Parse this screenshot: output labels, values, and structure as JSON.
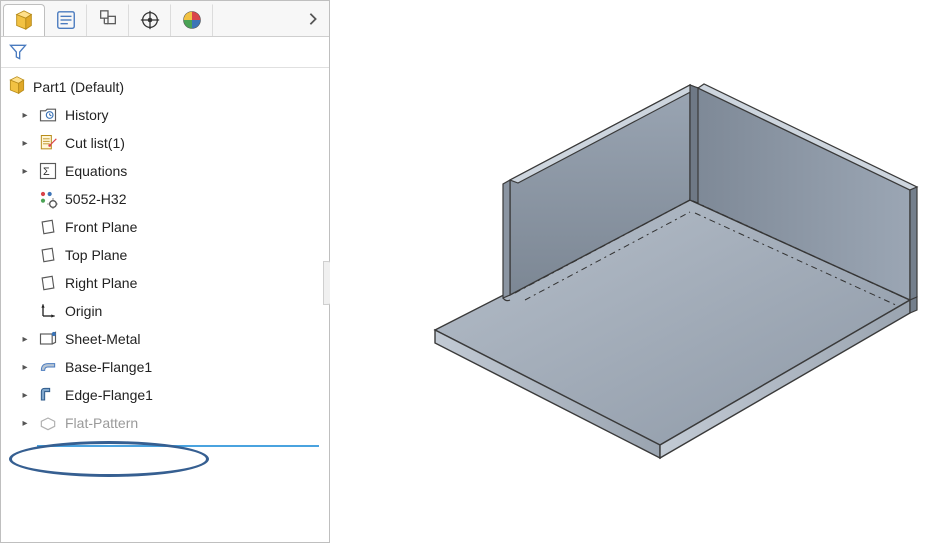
{
  "tabs": {
    "feature_tree": "Feature Manager",
    "property": "Property Manager",
    "config": "Configuration Manager",
    "dimx": "DimXpert",
    "display": "DisplayManager"
  },
  "tree": {
    "root_label": "Part1  (Default)",
    "items": [
      {
        "label": "History",
        "expandable": true,
        "icon": "history"
      },
      {
        "label": "Cut list(1)",
        "expandable": true,
        "icon": "cutlist"
      },
      {
        "label": "Equations",
        "expandable": true,
        "icon": "equations"
      },
      {
        "label": "5052-H32",
        "expandable": false,
        "icon": "material"
      },
      {
        "label": "Front Plane",
        "expandable": false,
        "icon": "plane"
      },
      {
        "label": "Top Plane",
        "expandable": false,
        "icon": "plane"
      },
      {
        "label": "Right Plane",
        "expandable": false,
        "icon": "plane"
      },
      {
        "label": "Origin",
        "expandable": false,
        "icon": "origin"
      },
      {
        "label": "Sheet-Metal",
        "expandable": true,
        "icon": "sheetmetal"
      },
      {
        "label": "Base-Flange1",
        "expandable": true,
        "icon": "baseflange"
      },
      {
        "label": "Edge-Flange1",
        "expandable": true,
        "icon": "edgeflange"
      },
      {
        "label": "Flat-Pattern",
        "expandable": true,
        "icon": "flatpattern",
        "disabled": true
      }
    ]
  }
}
